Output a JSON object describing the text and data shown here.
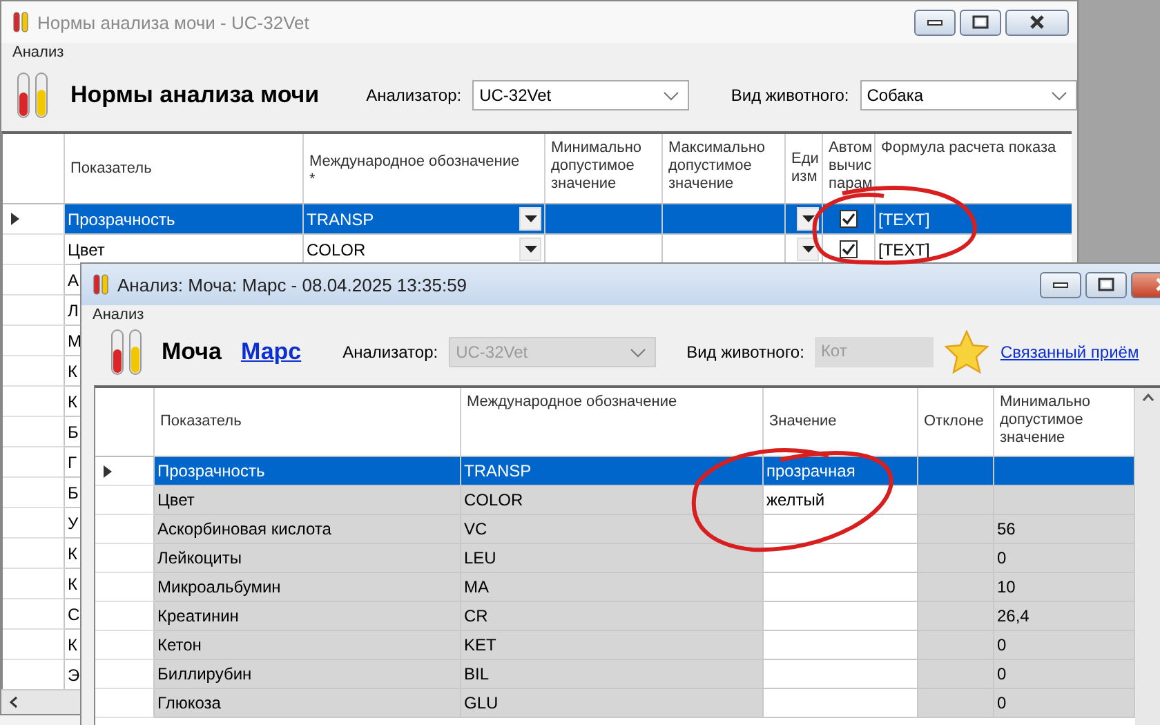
{
  "back_window": {
    "title": "Нормы анализа мочи - UC-32Vet",
    "menu": [
      "Анализ"
    ],
    "heading": "Нормы анализа мочи",
    "analyzer_label": "Анализатор:",
    "analyzer": "UC-32Vet",
    "animal_label": "Вид животного:",
    "animal": "Собака",
    "table": {
      "columns": [
        {
          "label": "Показатель"
        },
        {
          "label": "Международное обозначение",
          "mark": "*"
        },
        {
          "label": "Минимально допустимое значение"
        },
        {
          "label": "Максимально допустимое значение"
        },
        {
          "label": "Еди изм"
        },
        {
          "label": "Автом вычис парам"
        },
        {
          "label": "Формула расчета показа"
        }
      ],
      "rows": [
        {
          "name": "Прозрачность",
          "code": "TRANSP",
          "auto": true,
          "formula": "[TEXT]",
          "selected": true
        },
        {
          "name": "Цвет",
          "code": "COLOR",
          "auto": true,
          "formula": "[TEXT]",
          "selected": false
        },
        {
          "name": "А",
          "selected": false
        },
        {
          "name": "Л",
          "selected": false
        },
        {
          "name": "М",
          "selected": false
        },
        {
          "name": "К",
          "selected": false
        },
        {
          "name": "К",
          "selected": false
        },
        {
          "name": "Б",
          "selected": false
        },
        {
          "name": "Г",
          "selected": false
        },
        {
          "name": "Б",
          "selected": false
        },
        {
          "name": "У",
          "selected": false
        },
        {
          "name": "К",
          "selected": false
        },
        {
          "name": "К",
          "selected": false
        },
        {
          "name": "С",
          "selected": false
        },
        {
          "name": "К",
          "selected": false
        },
        {
          "name": "Э",
          "selected": false
        }
      ]
    }
  },
  "front_window": {
    "title": "Анализ: Моча: Марс - 08.04.2025 13:35:59",
    "menu": [
      "Анализ"
    ],
    "heading": "Моча",
    "patient_link": "Марс",
    "analyzer_label": "Анализатор:",
    "analyzer": "UC-32Vet",
    "analyzer_disabled": true,
    "animal_label": "Вид животного:",
    "animal": "Кот",
    "related_link": "Связанный приём",
    "table": {
      "columns": [
        {
          "label": "Показатель"
        },
        {
          "label": "Международное обозначение"
        },
        {
          "label": "Значение"
        },
        {
          "label": "Отклоне"
        },
        {
          "label": "Минимально допустимое значение"
        }
      ],
      "rows": [
        {
          "name": "Прозрачность",
          "code": "TRANSP",
          "value": "прозрачная",
          "selected": true
        },
        {
          "name": "Цвет",
          "code": "COLOR",
          "value": "желтый",
          "selected": false
        },
        {
          "name": "Аскорбиновая кислота",
          "code": "VC",
          "min": "56",
          "selected": false
        },
        {
          "name": "Лейкоциты",
          "code": "LEU",
          "min": "0",
          "selected": false
        },
        {
          "name": "Микроальбумин",
          "code": "MA",
          "min": "10",
          "selected": false
        },
        {
          "name": "Креатинин",
          "code": "CR",
          "min": "26,4",
          "selected": false
        },
        {
          "name": "Кетон",
          "code": "KET",
          "min": "0",
          "selected": false
        },
        {
          "name": "Биллирубин",
          "code": "BIL",
          "min": "0",
          "selected": false
        },
        {
          "name": "Глюкоза",
          "code": "GLU",
          "min": "0",
          "selected": false
        }
      ]
    }
  }
}
